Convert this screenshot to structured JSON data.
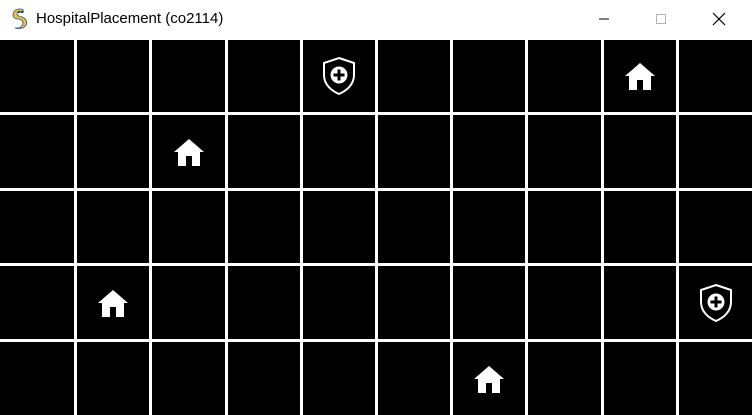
{
  "window": {
    "title": "HospitalPlacement (co2114)",
    "app_icon": "pygame-snake-icon",
    "controls": {
      "minimize_icon": "minimize-icon",
      "maximize_icon": "maximize-icon",
      "close_icon": "close-icon"
    }
  },
  "grid": {
    "rows": 5,
    "cols": 10,
    "background_color": "#000000",
    "line_color": "#ffffff",
    "icon_color": "#ffffff",
    "houses": [
      {
        "row": 0,
        "col": 8
      },
      {
        "row": 1,
        "col": 2
      },
      {
        "row": 3,
        "col": 1
      },
      {
        "row": 4,
        "col": 6
      }
    ],
    "hospitals": [
      {
        "row": 0,
        "col": 4
      },
      {
        "row": 3,
        "col": 9
      }
    ]
  }
}
